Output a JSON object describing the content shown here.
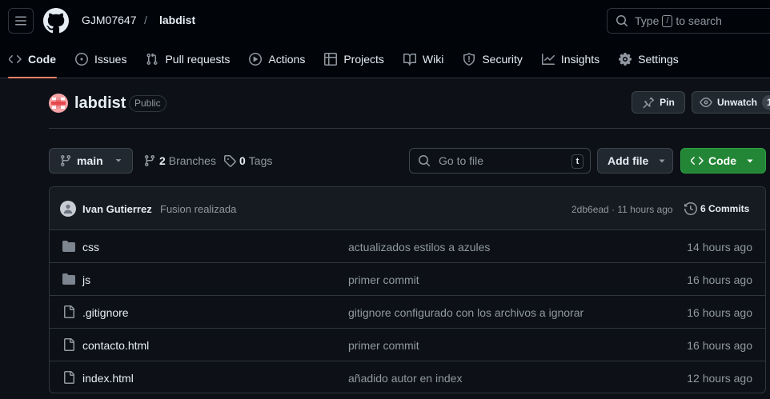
{
  "header": {
    "owner": "GJM07647",
    "separator": "/",
    "repo": "labdist",
    "search": {
      "prefix": "Type",
      "key": "/",
      "suffix": "to search"
    }
  },
  "nav": [
    {
      "label": "Code",
      "icon": "code-icon",
      "selected": true
    },
    {
      "label": "Issues",
      "icon": "issues-icon"
    },
    {
      "label": "Pull requests",
      "icon": "pull-request-icon"
    },
    {
      "label": "Actions",
      "icon": "play-icon"
    },
    {
      "label": "Projects",
      "icon": "table-icon"
    },
    {
      "label": "Wiki",
      "icon": "book-icon"
    },
    {
      "label": "Security",
      "icon": "shield-icon"
    },
    {
      "label": "Insights",
      "icon": "graph-icon"
    },
    {
      "label": "Settings",
      "icon": "gear-icon"
    }
  ],
  "repo": {
    "name": "labdist",
    "visibility": "Public",
    "pin_label": "Pin",
    "watch_label": "Unwatch",
    "watch_count": "1"
  },
  "toolbar": {
    "branch": "main",
    "branches_count": "2",
    "branches_label": "Branches",
    "tags_count": "0",
    "tags_label": "Tags",
    "goto_placeholder": "Go to file",
    "goto_key": "t",
    "add_file_label": "Add file",
    "code_label": "Code"
  },
  "commit": {
    "author": "Ivan Gutierrez",
    "message": "Fusion realizada",
    "meta": "2db6ead · 11 hours ago",
    "commits_label": "6 Commits"
  },
  "files": [
    {
      "name": "css",
      "type": "folder",
      "message": "actualizados estilos a azules",
      "time": "14 hours ago"
    },
    {
      "name": "js",
      "type": "folder",
      "message": "primer commit",
      "time": "16 hours ago"
    },
    {
      "name": ".gitignore",
      "type": "file",
      "message": "gitignore configurado con los archivos a ignorar",
      "time": "16 hours ago"
    },
    {
      "name": "contacto.html",
      "type": "file",
      "message": "primer commit",
      "time": "16 hours ago"
    },
    {
      "name": "index.html",
      "type": "file",
      "message": "añadido autor en index",
      "time": "12 hours ago"
    }
  ],
  "colors": {
    "background": "#0d1117",
    "header_background": "#010409",
    "selected_underline": "#f78166",
    "code_button": "#238636",
    "folder_icon": "#7d8590"
  }
}
